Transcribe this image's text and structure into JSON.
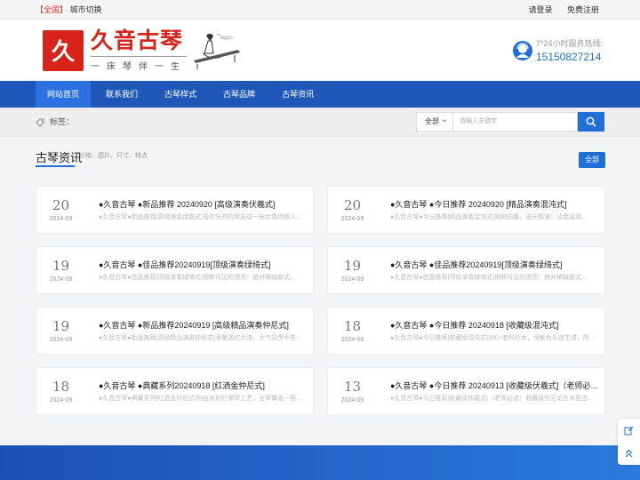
{
  "topbar": {
    "region_label": "【全国】",
    "city_switch": "城市切换",
    "login": "请登录",
    "register": "免费注册"
  },
  "header": {
    "logo_mark": "久",
    "logo_title": "久音古琴",
    "logo_slogan": "一床琴伴一生",
    "hotline_label": "7*24小时服务热线:",
    "hotline_number": "15150827214"
  },
  "nav": {
    "items": [
      {
        "label": "网站首页",
        "active": true
      },
      {
        "label": "联系我们",
        "active": false
      },
      {
        "label": "古琴样式",
        "active": false
      },
      {
        "label": "古琴品牌",
        "active": false
      },
      {
        "label": "古琴资讯",
        "active": false
      }
    ]
  },
  "filter": {
    "tag_label": "标签：",
    "select_value": "全部",
    "search_placeholder": "请输入关键字"
  },
  "section": {
    "title": "古琴资讯",
    "subtitle": "价格、图片、尺寸、特点",
    "all_button": "全部"
  },
  "articles": [
    {
      "day": "20",
      "ym": "2024-09",
      "title": "●久音古琴 ●新品推荐 20240920 [高级演奏伏羲式]",
      "desc": "●久音古琴●新品推荐|高级演奏伏羲式|喜欢沃然的琴友这一床给我闭眼入..."
    },
    {
      "day": "20",
      "ym": "2024-09",
      "title": "●久音古琴 ●今日推荐 20240920 [精品演奏混沌式]",
      "desc": "●久音古琴●今日推荐|精品演奏混沌式|刚刚拍摄，提升精湛！淡色温润..."
    },
    {
      "day": "19",
      "ym": "2024-09",
      "title": "●久音古琴 ●佳品推荐20240919[顶级演奏绿绮式]",
      "desc": "●久音古琴●佳品推荐|顶级演奏绿绮式|用断可见的漂亮！绝对稀缺款式..."
    },
    {
      "day": "19",
      "ym": "2024-09",
      "title": "●久音古琴 ●佳品推荐20240919[顶级演奏绿绮式]",
      "desc": "●久音古琴●佳品推荐|顶级演奏绿绮式|用断可见的漂亮！绝对稀缺款式..."
    },
    {
      "day": "19",
      "ym": "2024-09",
      "title": "●久音古琴 ●新品推荐20240919 [高级精品演奏仲尼式]",
      "desc": "●久音古琴●新品推荐|高级精品演奏仲尼式|深紫透红大漆，大气显贵不失..."
    },
    {
      "day": "18",
      "ym": "2024-09",
      "title": "●久音古琴 ●今日推荐 20240918 [收藏级混沌式]",
      "desc": "●久音古琴●今日推荐|收藏级混沌式|300+老料杉木，深紫色头道生漆，所..."
    },
    {
      "day": "18",
      "ym": "2024-09",
      "title": "●久音古琴 ●典藏系列20240918 [红洒金仲尼式]",
      "desc": "●久音古琴●典藏系列|红洒金仲尼式|构自床好红曜琴工艺，全琴攀盖一层..."
    },
    {
      "day": "13",
      "ym": "2024-09",
      "title": "●久音古琴 ●今日推荐 20240913 [收藏级伏羲式]（老师必选）",
      "desc": "●久音古琴●今日推荐|收藏级伏羲式|（老师必选）收藏级别无论在木质选..."
    }
  ],
  "colors": {
    "brand_red": "#d8231b",
    "nav_blue": "#1f57b8",
    "accent_blue": "#1f6fd6"
  },
  "icons": {
    "tag": "tag-icon",
    "search": "search-icon",
    "hotline": "customer-service-icon",
    "edit": "edit-icon",
    "top": "back-to-top-icon"
  }
}
